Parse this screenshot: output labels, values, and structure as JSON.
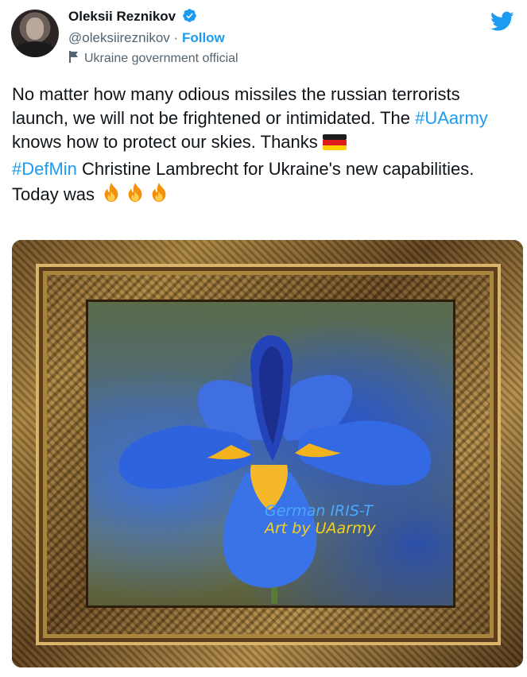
{
  "author": {
    "name": "Oleksii Reznikov",
    "handle": "@oleksiireznikov",
    "separator": "·",
    "follow_label": "Follow",
    "label": "Ukraine government official",
    "verified": true
  },
  "icons": {
    "verified": "verified-badge-icon",
    "flag": "government-flag-icon",
    "logo": "twitter-bird-icon",
    "emoji_flag": "germany-flag-emoji",
    "emoji_fire": "fire-emoji"
  },
  "tweet": {
    "line1": "No matter how many odious missiles the russian terrorists launch, we will not be frightened or intimidated. The ",
    "hashtag1": "#UAarmy",
    "line2": " knows how to protect our skies. Thanks ",
    "hashtag2": "#DefMin",
    "line3": " Christine Lambrecht for Ukraine's new capabilities.",
    "line4": "Today was "
  },
  "media": {
    "watermark_line1": "German IRIS-T",
    "watermark_line2": "Art by UAarmy"
  },
  "colors": {
    "link": "#1d9bf0",
    "text": "#0f1419",
    "secondary": "#536471",
    "watermark_blue": "#4aa8ff",
    "watermark_yellow": "#f3d21b"
  }
}
